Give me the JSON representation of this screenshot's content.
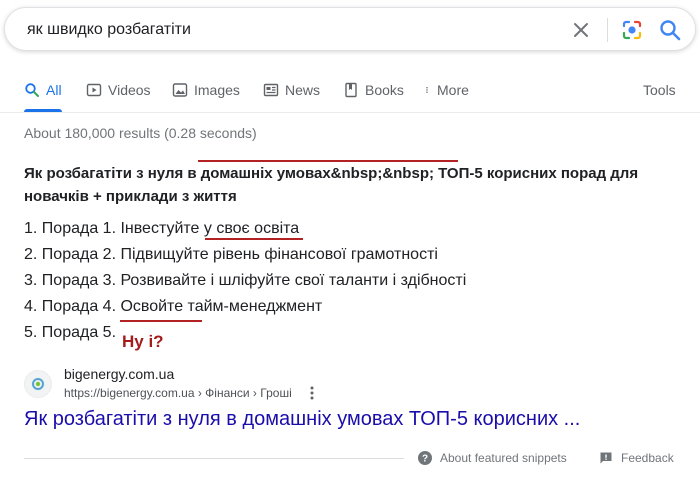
{
  "search": {
    "query": "як швидко розбагатіти"
  },
  "tabs": [
    {
      "label": "All",
      "icon": "search-icon",
      "active": true
    },
    {
      "label": "Videos",
      "icon": "video-icon"
    },
    {
      "label": "Images",
      "icon": "image-icon"
    },
    {
      "label": "News",
      "icon": "news-icon"
    },
    {
      "label": "Books",
      "icon": "book-icon"
    },
    {
      "label": "More",
      "icon": "more-vert-icon"
    }
  ],
  "tools_label": "Tools",
  "result_stats": "About 180,000 results (0.28 seconds)",
  "snippet": {
    "title": "Як розбагатіти з нуля в домашніх умовах&nbsp;&nbsp; ТОП-5 корисних порад для новачків + приклади з життя",
    "items": [
      "1. Порада 1. Інвестуйте у своє освіта",
      "2. Порада 2. Підвищуйте рівень фінансової грамотності",
      "3. Порада 3. Розвивайте і шліфуйте свої таланти і здібності",
      "4. Порада 4. Освойте тайм-менеджмент",
      "5. Порада 5."
    ],
    "annotation": "Ну і?",
    "annotation_color": "#a51b1b"
  },
  "source": {
    "site_name": "bigenergy.com.ua",
    "breadcrumb": "https://bigenergy.com.ua › Фінанси › Гроші",
    "link_title": "Як розбагатіти з нуля в домашніх умовах ТОП-5 корисних ...",
    "link_color": "#1a0dab"
  },
  "footer": {
    "about_label": "About featured snippets",
    "feedback_label": "Feedback"
  },
  "colors": {
    "accent": "#1a73e8",
    "annotation_red": "#b22222"
  }
}
